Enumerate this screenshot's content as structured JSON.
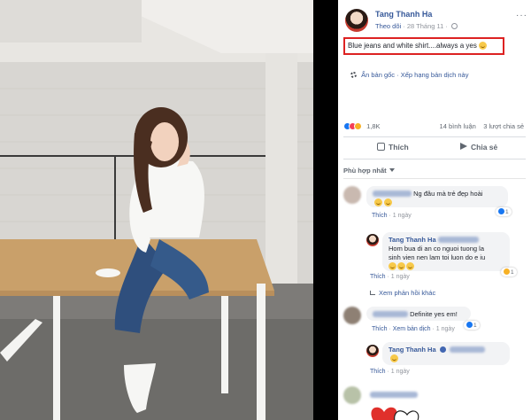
{
  "post": {
    "author": "Tang Thanh Ha",
    "follow": "Theo dõi",
    "time": "28 Tháng 11",
    "menu": "···",
    "caption": "Blue jeans and white shirt....always a yes",
    "see_original": "Ẩn bản gốc",
    "rate_translation": "Xếp hạng bản dịch này",
    "reaction_count": "1,8K",
    "comment_count": "14 bình luận",
    "share_count": "3 lượt chia sẻ",
    "like_label": "Thích",
    "share_label": "Chia sẻ",
    "sort_label": "Phù hợp nhất"
  },
  "comments": [
    {
      "text": "Ng đâu mà trẻ đẹp hoài",
      "like_label": "Thích",
      "time": "1 ngày",
      "reactions": "1"
    },
    {
      "author": "Tang Thanh Ha",
      "text_line1": "Hom bua di an co nguoi tuong la",
      "text_line2": "sinh vien nen lam toi luon do e iu",
      "like_label": "Thích",
      "time": "1 ngày",
      "reactions": "1"
    },
    {
      "more_replies": "Xem phản hồi khác"
    },
    {
      "text": "Definite yes em!",
      "like_label": "Thích",
      "see_translation": "Xem bản dịch",
      "time": "1 ngày",
      "reactions": "1"
    },
    {
      "author": "Tang Thanh Ha",
      "like_label": "Thích",
      "time": "1 ngày"
    }
  ],
  "colors": {
    "link": "#365899",
    "highlight_box": "#dd2222",
    "like_blue": "#1877f2"
  }
}
